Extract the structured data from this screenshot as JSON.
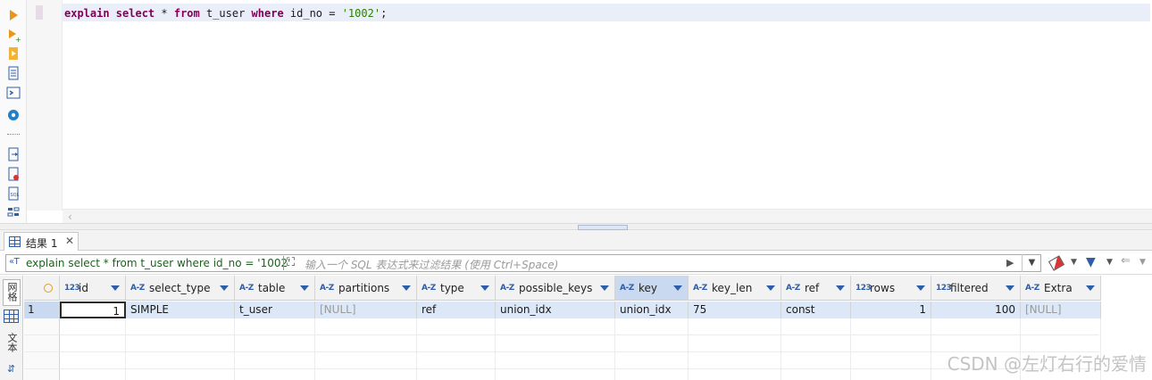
{
  "editor": {
    "sql": {
      "kw1": "explain select",
      "star": " * ",
      "kw2": "from",
      "tbl": " t_user ",
      "kw3": "where",
      "cond": " id_no = ",
      "val": "'1002'",
      "end": ";"
    }
  },
  "result_tab": {
    "label": "结果 1"
  },
  "filter": {
    "query": "explain select * from t_user where id_no = '1002'",
    "placeholder": "输入一个 SQL 表达式来过滤结果 (使用 Ctrl+Space)"
  },
  "side_tabs": {
    "grid": "网格",
    "text": "文本"
  },
  "columns": [
    {
      "type": "123",
      "name": "id"
    },
    {
      "type": "A-Z",
      "name": "select_type"
    },
    {
      "type": "A-Z",
      "name": "table"
    },
    {
      "type": "A-Z",
      "name": "partitions"
    },
    {
      "type": "A-Z",
      "name": "type"
    },
    {
      "type": "A-Z",
      "name": "possible_keys"
    },
    {
      "type": "A-Z",
      "name": "key"
    },
    {
      "type": "A-Z",
      "name": "key_len"
    },
    {
      "type": "A-Z",
      "name": "ref"
    },
    {
      "type": "123",
      "name": "rows"
    },
    {
      "type": "123",
      "name": "filtered"
    },
    {
      "type": "A-Z",
      "name": "Extra"
    }
  ],
  "rows": [
    {
      "num": "1",
      "cells": [
        "1",
        "SIMPLE",
        "t_user",
        "[NULL]",
        "ref",
        "union_idx",
        "union_idx",
        "75",
        "const",
        "1",
        "100",
        "[NULL]"
      ]
    }
  ],
  "watermark": "CSDN @左灯右行的爱情"
}
